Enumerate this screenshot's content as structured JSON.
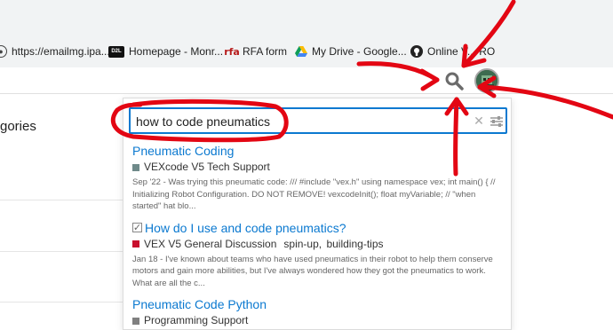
{
  "bookmarks": [
    {
      "label": "https://emailmg.ipa...",
      "icon": "globe-icon"
    },
    {
      "label": "Homepage - Monr...",
      "icon": "d2l-logo-icon",
      "badge": "D2L"
    },
    {
      "label": "RFA form",
      "icon": "rfa-logo-icon",
      "badge": "rfa"
    },
    {
      "label": "My Drive - Google...",
      "icon": "google-drive-icon"
    },
    {
      "label": "Online V... RO",
      "icon": "github-icon"
    }
  ],
  "page": {
    "category_heading": "gories"
  },
  "search": {
    "value": "how to code pneumatics",
    "clear_icon": "close-icon",
    "advanced_icon": "sliders-icon"
  },
  "results": [
    {
      "title": "Pneumatic Coding",
      "category": "VEXcode V5 Tech Support",
      "category_color": "#6f8a8a",
      "blurb": "Sep '22 - Was trying this pneumatic code: /// #include \"vex.h\" using namespace vex; int main() { // Initializing Robot Configuration. DO NOT REMOVE! vexcodeInit(); float myVariable; // \"when started\" hat blo..."
    },
    {
      "title": "How do I use and code pneumatics?",
      "solved": true,
      "category": "VEX V5 General Discussion",
      "category_color": "#c8102e",
      "tags": [
        "spin-up,",
        "building-tips"
      ],
      "blurb": "Jan 18 - I've known about teams who have used pneumatics in their robot to help them conserve motors and gain more abilities, but I've always wondered how they got the pneumatics to work. What are all the c..."
    },
    {
      "title": "Pneumatic Code Python",
      "category": "Programming Support",
      "category_color": "#808080"
    }
  ],
  "colors": {
    "accent": "#0b79d0",
    "annotation": "#e30613"
  }
}
